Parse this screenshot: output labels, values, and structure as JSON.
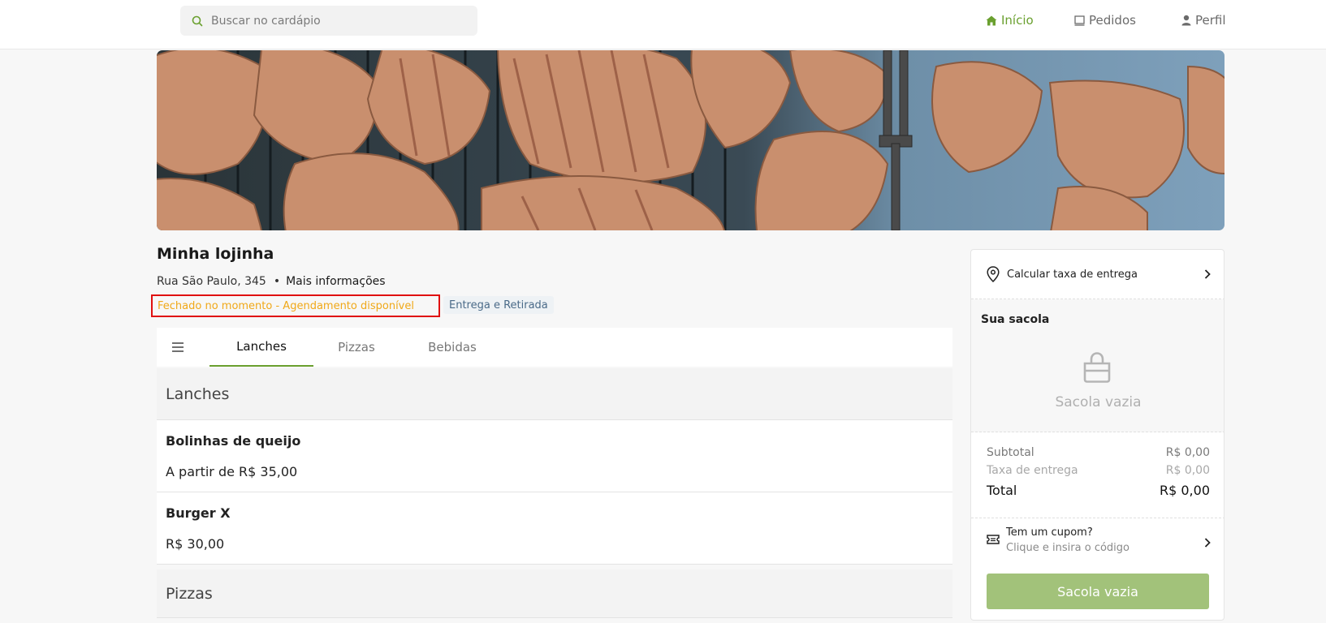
{
  "header": {
    "search": {
      "placeholder": "Buscar no cardápio",
      "value": ""
    },
    "nav": [
      {
        "label": "Início",
        "icon": "home-icon",
        "active": true
      },
      {
        "label": "Pedidos",
        "icon": "receipt-icon",
        "active": false
      },
      {
        "label": "Perfil",
        "icon": "user-icon",
        "active": false
      }
    ]
  },
  "banner": {
    "image": "grilled-meat-banner"
  },
  "store": {
    "name": "Minha lojinha",
    "address": "Rua São Paulo, 345",
    "more_info": "Mais informações",
    "status": "Fechado no momento - Agendamento disponível",
    "service_mode": "Entrega e Retirada"
  },
  "tabs": [
    "Lanches",
    "Pizzas",
    "Bebidas"
  ],
  "menu": {
    "sections": [
      {
        "title": "Lanches",
        "items": [
          {
            "name": "Bolinhas de queijo",
            "price": "A partir de R$ 35,00"
          },
          {
            "name": "Burger X",
            "price": "R$ 30,00"
          }
        ]
      },
      {
        "title": "Pizzas",
        "items": []
      }
    ]
  },
  "bag": {
    "calc_delivery": "Calcular taxa de entrega",
    "title": "Sua sacola",
    "empty_text": "Sacola vazia",
    "subtotal_label": "Subtotal",
    "subtotal_value": "R$ 0,00",
    "fee_label": "Taxa de entrega",
    "fee_value": "R$ 0,00",
    "total_label": "Total",
    "total_value": "R$ 0,00",
    "coupon_title": "Tem um cupom?",
    "coupon_subtitle": "Clique e insira o código",
    "button_label": "Sacola vazia"
  },
  "colors": {
    "accent": "#6aa02f",
    "status_text": "#f0a818",
    "highlight_border": "#e01010",
    "button_disabled": "#a2c27a"
  }
}
